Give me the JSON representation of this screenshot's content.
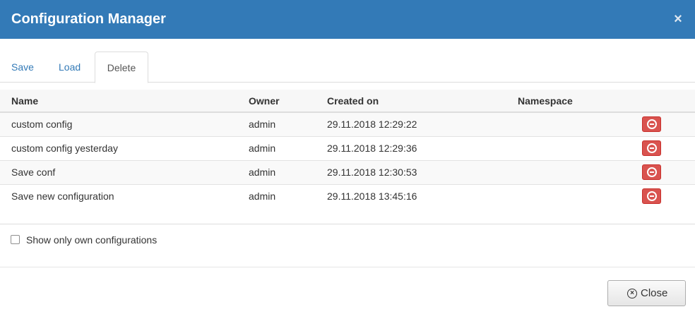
{
  "dialog": {
    "title": "Configuration Manager",
    "close_icon": "×"
  },
  "tabs": [
    {
      "label": "Save"
    },
    {
      "label": "Load"
    },
    {
      "label": "Delete",
      "active": true
    }
  ],
  "table": {
    "columns": {
      "name": "Name",
      "owner": "Owner",
      "created_on": "Created on",
      "namespace": "Namespace"
    },
    "rows": [
      {
        "name": "custom config",
        "owner": "admin",
        "created_on": "29.11.2018 12:29:22",
        "namespace": ""
      },
      {
        "name": "custom config yesterday",
        "owner": "admin",
        "created_on": "29.11.2018 12:29:36",
        "namespace": ""
      },
      {
        "name": "Save conf",
        "owner": "admin",
        "created_on": "29.11.2018 12:30:53",
        "namespace": ""
      },
      {
        "name": "Save new configuration",
        "owner": "admin",
        "created_on": "29.11.2018 13:45:16",
        "namespace": ""
      }
    ],
    "row_action_icon": "minus-circle-icon"
  },
  "filter": {
    "label": "Show only own configurations",
    "checked": false
  },
  "footer": {
    "close_label": "Close",
    "close_icon": "×"
  },
  "colors": {
    "header_bg": "#337ab7",
    "tab_link": "#337ab7",
    "delete_button": "#d9534f"
  }
}
